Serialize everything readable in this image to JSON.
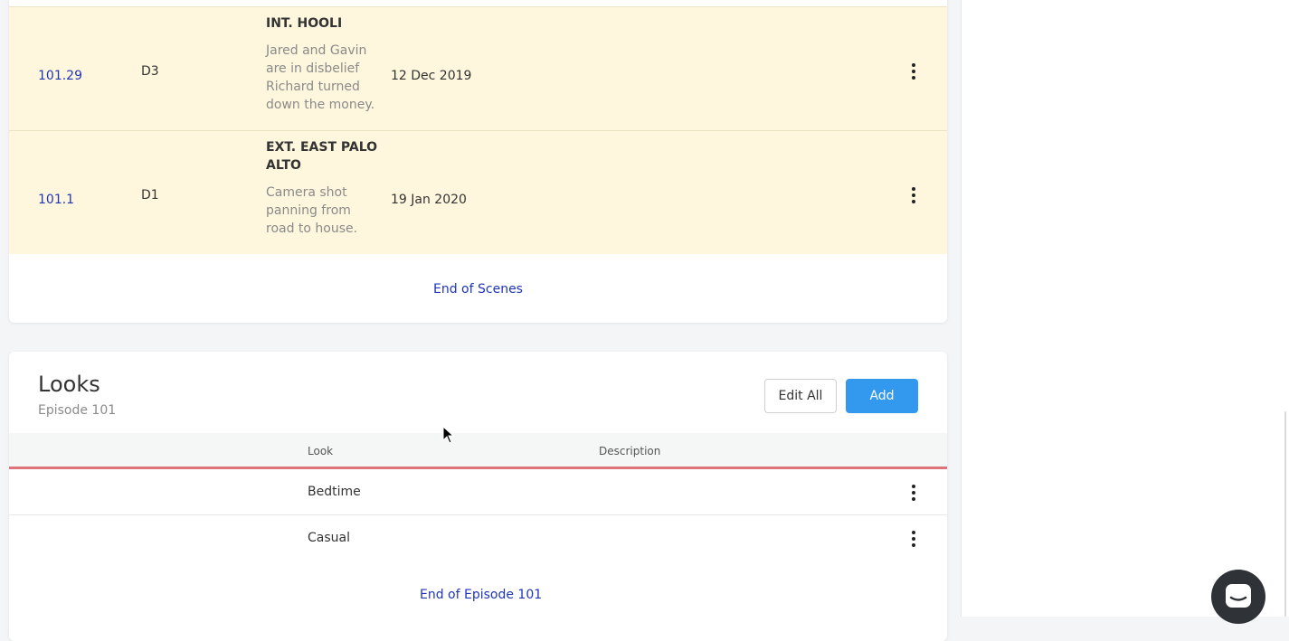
{
  "scenes": {
    "rows": [
      {
        "number": "101.29",
        "day": "D3",
        "slug": "INT. HOOLI",
        "description": "Jared and Gavin are in disbelief Richard turned down the money.",
        "date": "12 Dec 2019"
      },
      {
        "number": "101.1",
        "day": "D1",
        "slug": "EXT. EAST PALO ALTO",
        "description": "Camera shot panning from road to house.",
        "date": "19 Jan 2020"
      }
    ],
    "end_label": "End of Scenes"
  },
  "looks": {
    "title": "Looks",
    "subtitle": "Episode 101",
    "edit_all_label": "Edit All",
    "add_label": "Add",
    "columns": {
      "look": "Look",
      "description": "Description"
    },
    "rows": [
      {
        "name": "Bedtime",
        "description": ""
      },
      {
        "name": "Casual",
        "description": ""
      }
    ],
    "end_label": "End of Episode 101"
  },
  "icons": {
    "row_menu": "kebab-menu-icon",
    "chat": "chat-icon",
    "cursor": "mouse-pointer-icon"
  },
  "colors": {
    "accent": "#3399ee",
    "link": "#1f35b8",
    "highlight_row": "#fef7dd",
    "header_divider": "#dc7479"
  }
}
